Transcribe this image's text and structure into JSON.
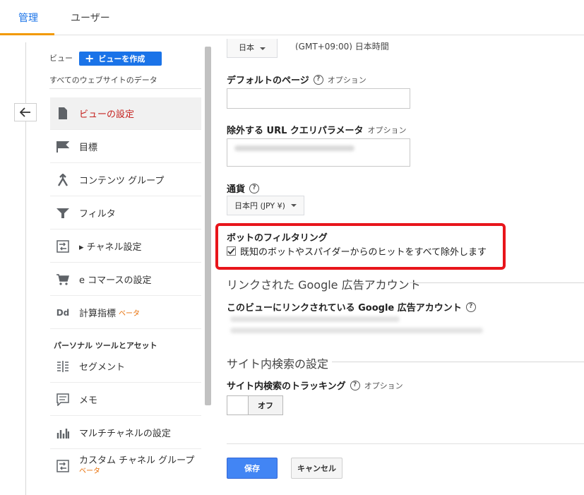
{
  "tabs": [
    {
      "label": "管理",
      "active": true
    },
    {
      "label": "ユーザー",
      "active": false
    }
  ],
  "sidebar": {
    "view_label": "ビュー",
    "create_view_button": "ビューを作成",
    "view_description": "すべてのウェブサイトのデータ",
    "items": [
      {
        "label": "ビューの設定",
        "icon": "document-icon",
        "active": true
      },
      {
        "label": "目標",
        "icon": "flag-icon"
      },
      {
        "label": "コンテンツ グループ",
        "icon": "content-group-icon"
      },
      {
        "label": "フィルタ",
        "icon": "filter-icon"
      },
      {
        "label": "▸ チャネル設定",
        "icon": "channel-icon"
      },
      {
        "label": "e コマースの設定",
        "icon": "cart-icon"
      },
      {
        "label": "計算指標",
        "icon": "dd-icon",
        "badge": "ベータ"
      }
    ],
    "personal_section_title": "パーソナル ツールとアセット",
    "personal_items": [
      {
        "label": "セグメント",
        "icon": "segment-icon"
      },
      {
        "label": "メモ",
        "icon": "memo-icon"
      },
      {
        "label": "マルチチャネルの設定",
        "icon": "bar-chart-icon"
      },
      {
        "label": "カスタム チャネル グループ",
        "icon": "channel-icon",
        "badge": "ベータ"
      }
    ]
  },
  "form": {
    "top_select_value": "日本",
    "timezone_text": "(GMT+09:00) 日本時間",
    "default_page_label": "デフォルトのページ",
    "default_page_optional": "オプション",
    "default_page_value": "",
    "exclude_url_label": "除外する URL クエリパラメータ",
    "exclude_url_optional": "オプション",
    "currency_label": "通貨",
    "currency_value": "日本円 (JPY ¥)",
    "bot_filter_title": "ボットのフィルタリング",
    "bot_filter_checkbox": "既知のボットやスパイダーからのヒットをすべて除外します",
    "bot_filter_checked": true,
    "linked_ads_heading": "リンクされた Google 広告アカウント",
    "linked_ads_label": "このビューにリンクされている Google 広告アカウント",
    "site_search_heading": "サイト内検索の設定",
    "site_search_label": "サイト内検索のトラッキング",
    "site_search_optional": "オプション",
    "site_search_toggle": "オフ",
    "save_button": "保存",
    "cancel_button": "キャンセル"
  },
  "colors": {
    "accent": "#1a73e8",
    "active_red": "#c5221f",
    "highlight_box": "#e8151b",
    "tab_underline": "#f29900",
    "beta": "#e8710a"
  }
}
